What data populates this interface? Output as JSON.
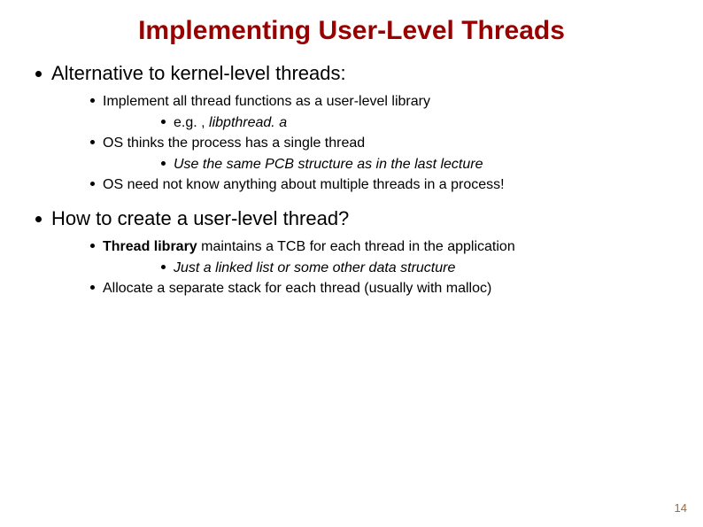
{
  "title": "Implementing User-Level Threads",
  "sections": [
    {
      "heading": "Alternative to kernel-level threads:",
      "items": [
        {
          "text": "Implement all thread functions as a user-level library",
          "sub": [
            {
              "prefix": "e.g. , ",
              "em": "libpthread. a"
            }
          ]
        },
        {
          "text": "OS thinks the process has a single thread",
          "sub": [
            {
              "em": "Use the same PCB structure as in the last lecture"
            }
          ]
        },
        {
          "text": "OS need not know anything about multiple threads in a process!"
        }
      ]
    },
    {
      "heading": "How to create a user-level thread?",
      "items": [
        {
          "bold": "Thread library",
          "text_after": " maintains a TCB for each thread in the application",
          "sub": [
            {
              "em": "Just a linked list or some other data structure"
            }
          ]
        },
        {
          "text": "Allocate a separate stack for each thread (usually with malloc)"
        }
      ]
    }
  ],
  "page_number": "14"
}
